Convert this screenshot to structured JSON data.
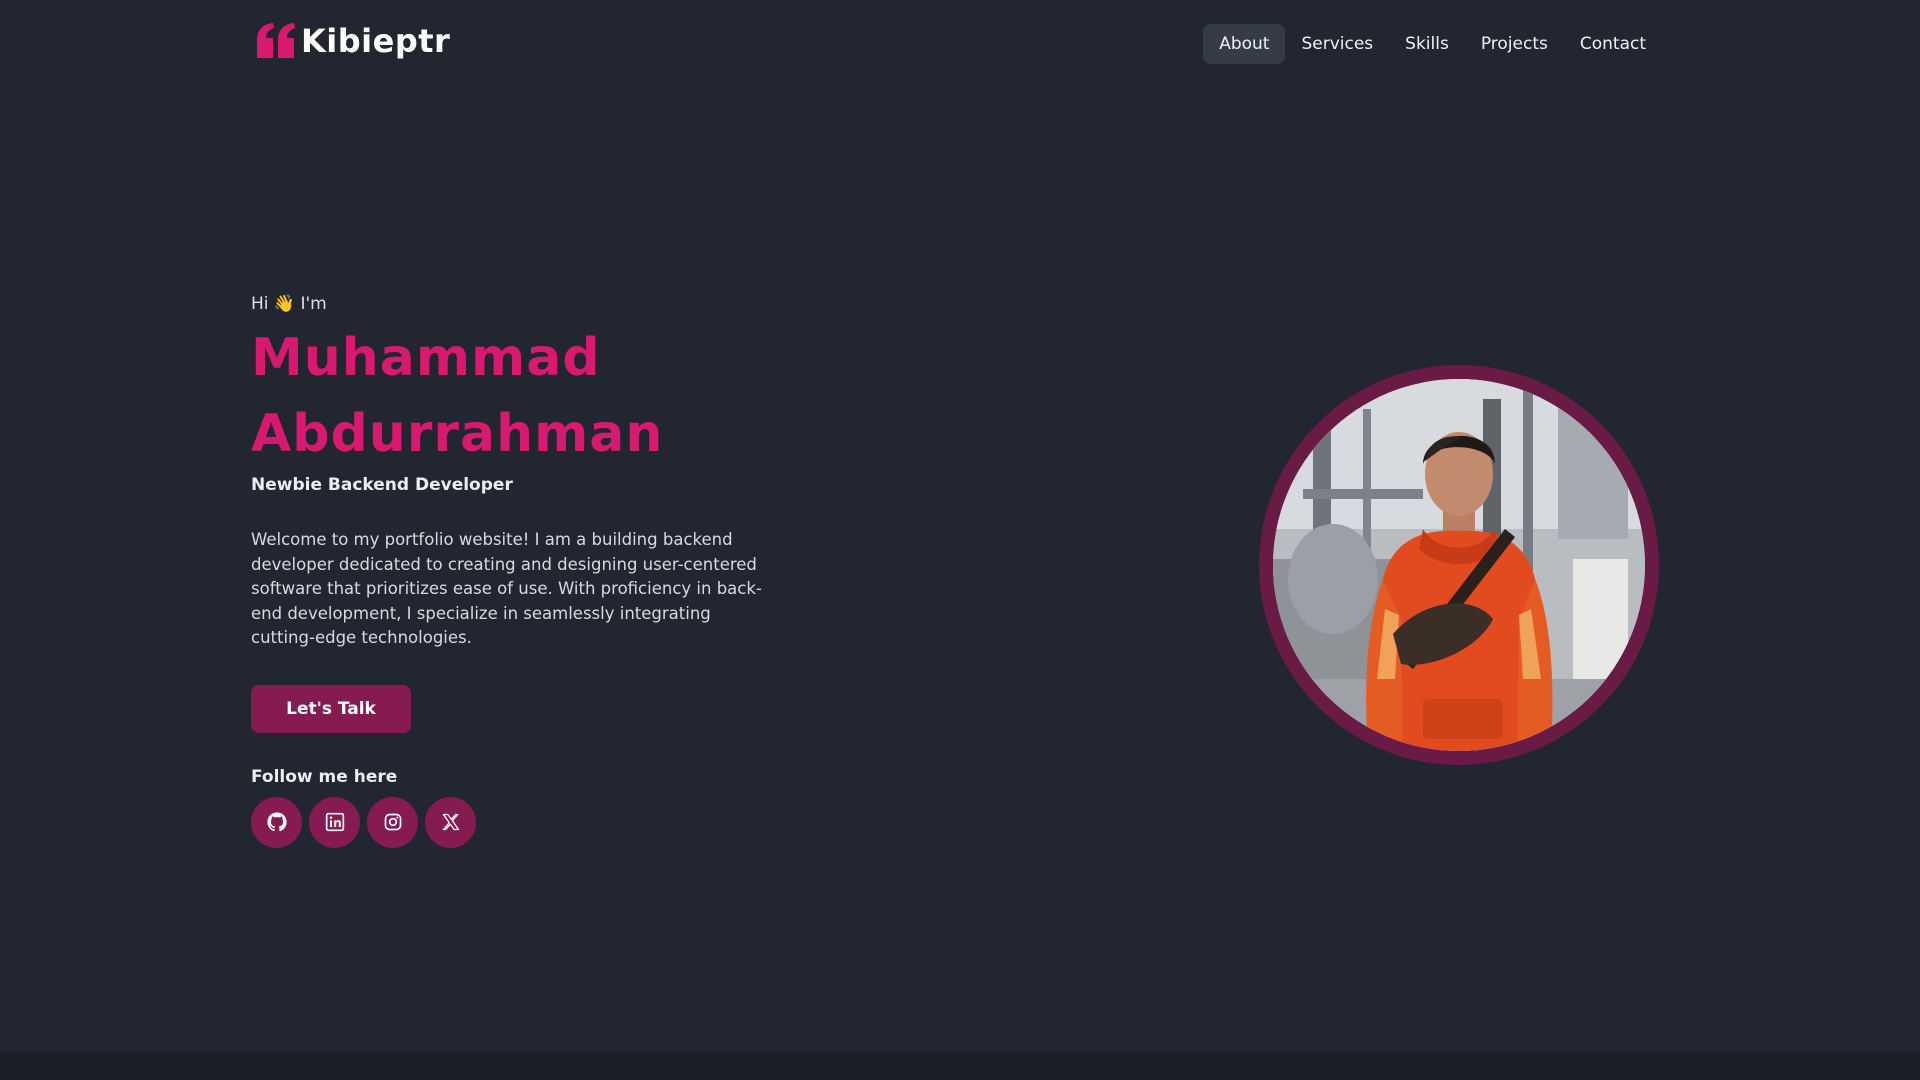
{
  "brand": {
    "name": "Kibieptr",
    "accent_color": "#d8196f",
    "button_color": "#861b51",
    "background_color": "#212630"
  },
  "nav": {
    "items": [
      {
        "label": "About",
        "active": true
      },
      {
        "label": "Services",
        "active": false
      },
      {
        "label": "Skills",
        "active": false
      },
      {
        "label": "Projects",
        "active": false
      },
      {
        "label": "Contact",
        "active": false
      }
    ]
  },
  "hero": {
    "greeting": "Hi 👋 I'm",
    "name_line1": "Muhammad",
    "name_line2": "Abdurrahman",
    "role": "Newbie Backend Developer",
    "bio": "Welcome to my portfolio website! I am a building backend developer dedicated to creating and designing user-centered software that prioritizes ease of use. With proficiency in back-end development, I specialize in seamlessly integrating cutting-edge technologies.",
    "cta_label": "Let's Talk",
    "follow_label": "Follow me here",
    "socials": [
      {
        "icon": "github-icon"
      },
      {
        "icon": "linkedin-icon"
      },
      {
        "icon": "instagram-icon"
      },
      {
        "icon": "x-icon"
      }
    ]
  },
  "avatar": {
    "icon": "profile-photo"
  }
}
